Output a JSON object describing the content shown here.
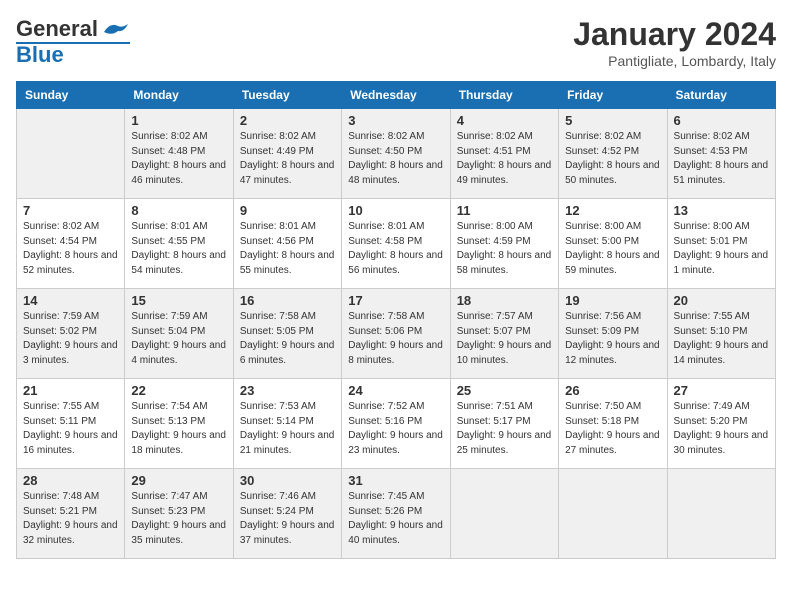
{
  "logo": {
    "general": "General",
    "blue": "Blue"
  },
  "title": "January 2024",
  "location": "Pantigliate, Lombardy, Italy",
  "days_of_week": [
    "Sunday",
    "Monday",
    "Tuesday",
    "Wednesday",
    "Thursday",
    "Friday",
    "Saturday"
  ],
  "weeks": [
    [
      {
        "date": "",
        "empty": true
      },
      {
        "date": "1",
        "sunrise": "8:02 AM",
        "sunset": "4:48 PM",
        "daylight": "8 hours and 46 minutes."
      },
      {
        "date": "2",
        "sunrise": "8:02 AM",
        "sunset": "4:49 PM",
        "daylight": "8 hours and 47 minutes."
      },
      {
        "date": "3",
        "sunrise": "8:02 AM",
        "sunset": "4:50 PM",
        "daylight": "8 hours and 48 minutes."
      },
      {
        "date": "4",
        "sunrise": "8:02 AM",
        "sunset": "4:51 PM",
        "daylight": "8 hours and 49 minutes."
      },
      {
        "date": "5",
        "sunrise": "8:02 AM",
        "sunset": "4:52 PM",
        "daylight": "8 hours and 50 minutes."
      },
      {
        "date": "6",
        "sunrise": "8:02 AM",
        "sunset": "4:53 PM",
        "daylight": "8 hours and 51 minutes."
      }
    ],
    [
      {
        "date": "7",
        "sunrise": "8:02 AM",
        "sunset": "4:54 PM",
        "daylight": "8 hours and 52 minutes."
      },
      {
        "date": "8",
        "sunrise": "8:01 AM",
        "sunset": "4:55 PM",
        "daylight": "8 hours and 54 minutes."
      },
      {
        "date": "9",
        "sunrise": "8:01 AM",
        "sunset": "4:56 PM",
        "daylight": "8 hours and 55 minutes."
      },
      {
        "date": "10",
        "sunrise": "8:01 AM",
        "sunset": "4:58 PM",
        "daylight": "8 hours and 56 minutes."
      },
      {
        "date": "11",
        "sunrise": "8:00 AM",
        "sunset": "4:59 PM",
        "daylight": "8 hours and 58 minutes."
      },
      {
        "date": "12",
        "sunrise": "8:00 AM",
        "sunset": "5:00 PM",
        "daylight": "8 hours and 59 minutes."
      },
      {
        "date": "13",
        "sunrise": "8:00 AM",
        "sunset": "5:01 PM",
        "daylight": "9 hours and 1 minute."
      }
    ],
    [
      {
        "date": "14",
        "sunrise": "7:59 AM",
        "sunset": "5:02 PM",
        "daylight": "9 hours and 3 minutes."
      },
      {
        "date": "15",
        "sunrise": "7:59 AM",
        "sunset": "5:04 PM",
        "daylight": "9 hours and 4 minutes."
      },
      {
        "date": "16",
        "sunrise": "7:58 AM",
        "sunset": "5:05 PM",
        "daylight": "9 hours and 6 minutes."
      },
      {
        "date": "17",
        "sunrise": "7:58 AM",
        "sunset": "5:06 PM",
        "daylight": "9 hours and 8 minutes."
      },
      {
        "date": "18",
        "sunrise": "7:57 AM",
        "sunset": "5:07 PM",
        "daylight": "9 hours and 10 minutes."
      },
      {
        "date": "19",
        "sunrise": "7:56 AM",
        "sunset": "5:09 PM",
        "daylight": "9 hours and 12 minutes."
      },
      {
        "date": "20",
        "sunrise": "7:55 AM",
        "sunset": "5:10 PM",
        "daylight": "9 hours and 14 minutes."
      }
    ],
    [
      {
        "date": "21",
        "sunrise": "7:55 AM",
        "sunset": "5:11 PM",
        "daylight": "9 hours and 16 minutes."
      },
      {
        "date": "22",
        "sunrise": "7:54 AM",
        "sunset": "5:13 PM",
        "daylight": "9 hours and 18 minutes."
      },
      {
        "date": "23",
        "sunrise": "7:53 AM",
        "sunset": "5:14 PM",
        "daylight": "9 hours and 21 minutes."
      },
      {
        "date": "24",
        "sunrise": "7:52 AM",
        "sunset": "5:16 PM",
        "daylight": "9 hours and 23 minutes."
      },
      {
        "date": "25",
        "sunrise": "7:51 AM",
        "sunset": "5:17 PM",
        "daylight": "9 hours and 25 minutes."
      },
      {
        "date": "26",
        "sunrise": "7:50 AM",
        "sunset": "5:18 PM",
        "daylight": "9 hours and 27 minutes."
      },
      {
        "date": "27",
        "sunrise": "7:49 AM",
        "sunset": "5:20 PM",
        "daylight": "9 hours and 30 minutes."
      }
    ],
    [
      {
        "date": "28",
        "sunrise": "7:48 AM",
        "sunset": "5:21 PM",
        "daylight": "9 hours and 32 minutes."
      },
      {
        "date": "29",
        "sunrise": "7:47 AM",
        "sunset": "5:23 PM",
        "daylight": "9 hours and 35 minutes."
      },
      {
        "date": "30",
        "sunrise": "7:46 AM",
        "sunset": "5:24 PM",
        "daylight": "9 hours and 37 minutes."
      },
      {
        "date": "31",
        "sunrise": "7:45 AM",
        "sunset": "5:26 PM",
        "daylight": "9 hours and 40 minutes."
      },
      {
        "date": "",
        "empty": true
      },
      {
        "date": "",
        "empty": true
      },
      {
        "date": "",
        "empty": true
      }
    ]
  ],
  "labels": {
    "sunrise": "Sunrise:",
    "sunset": "Sunset:",
    "daylight": "Daylight:"
  }
}
